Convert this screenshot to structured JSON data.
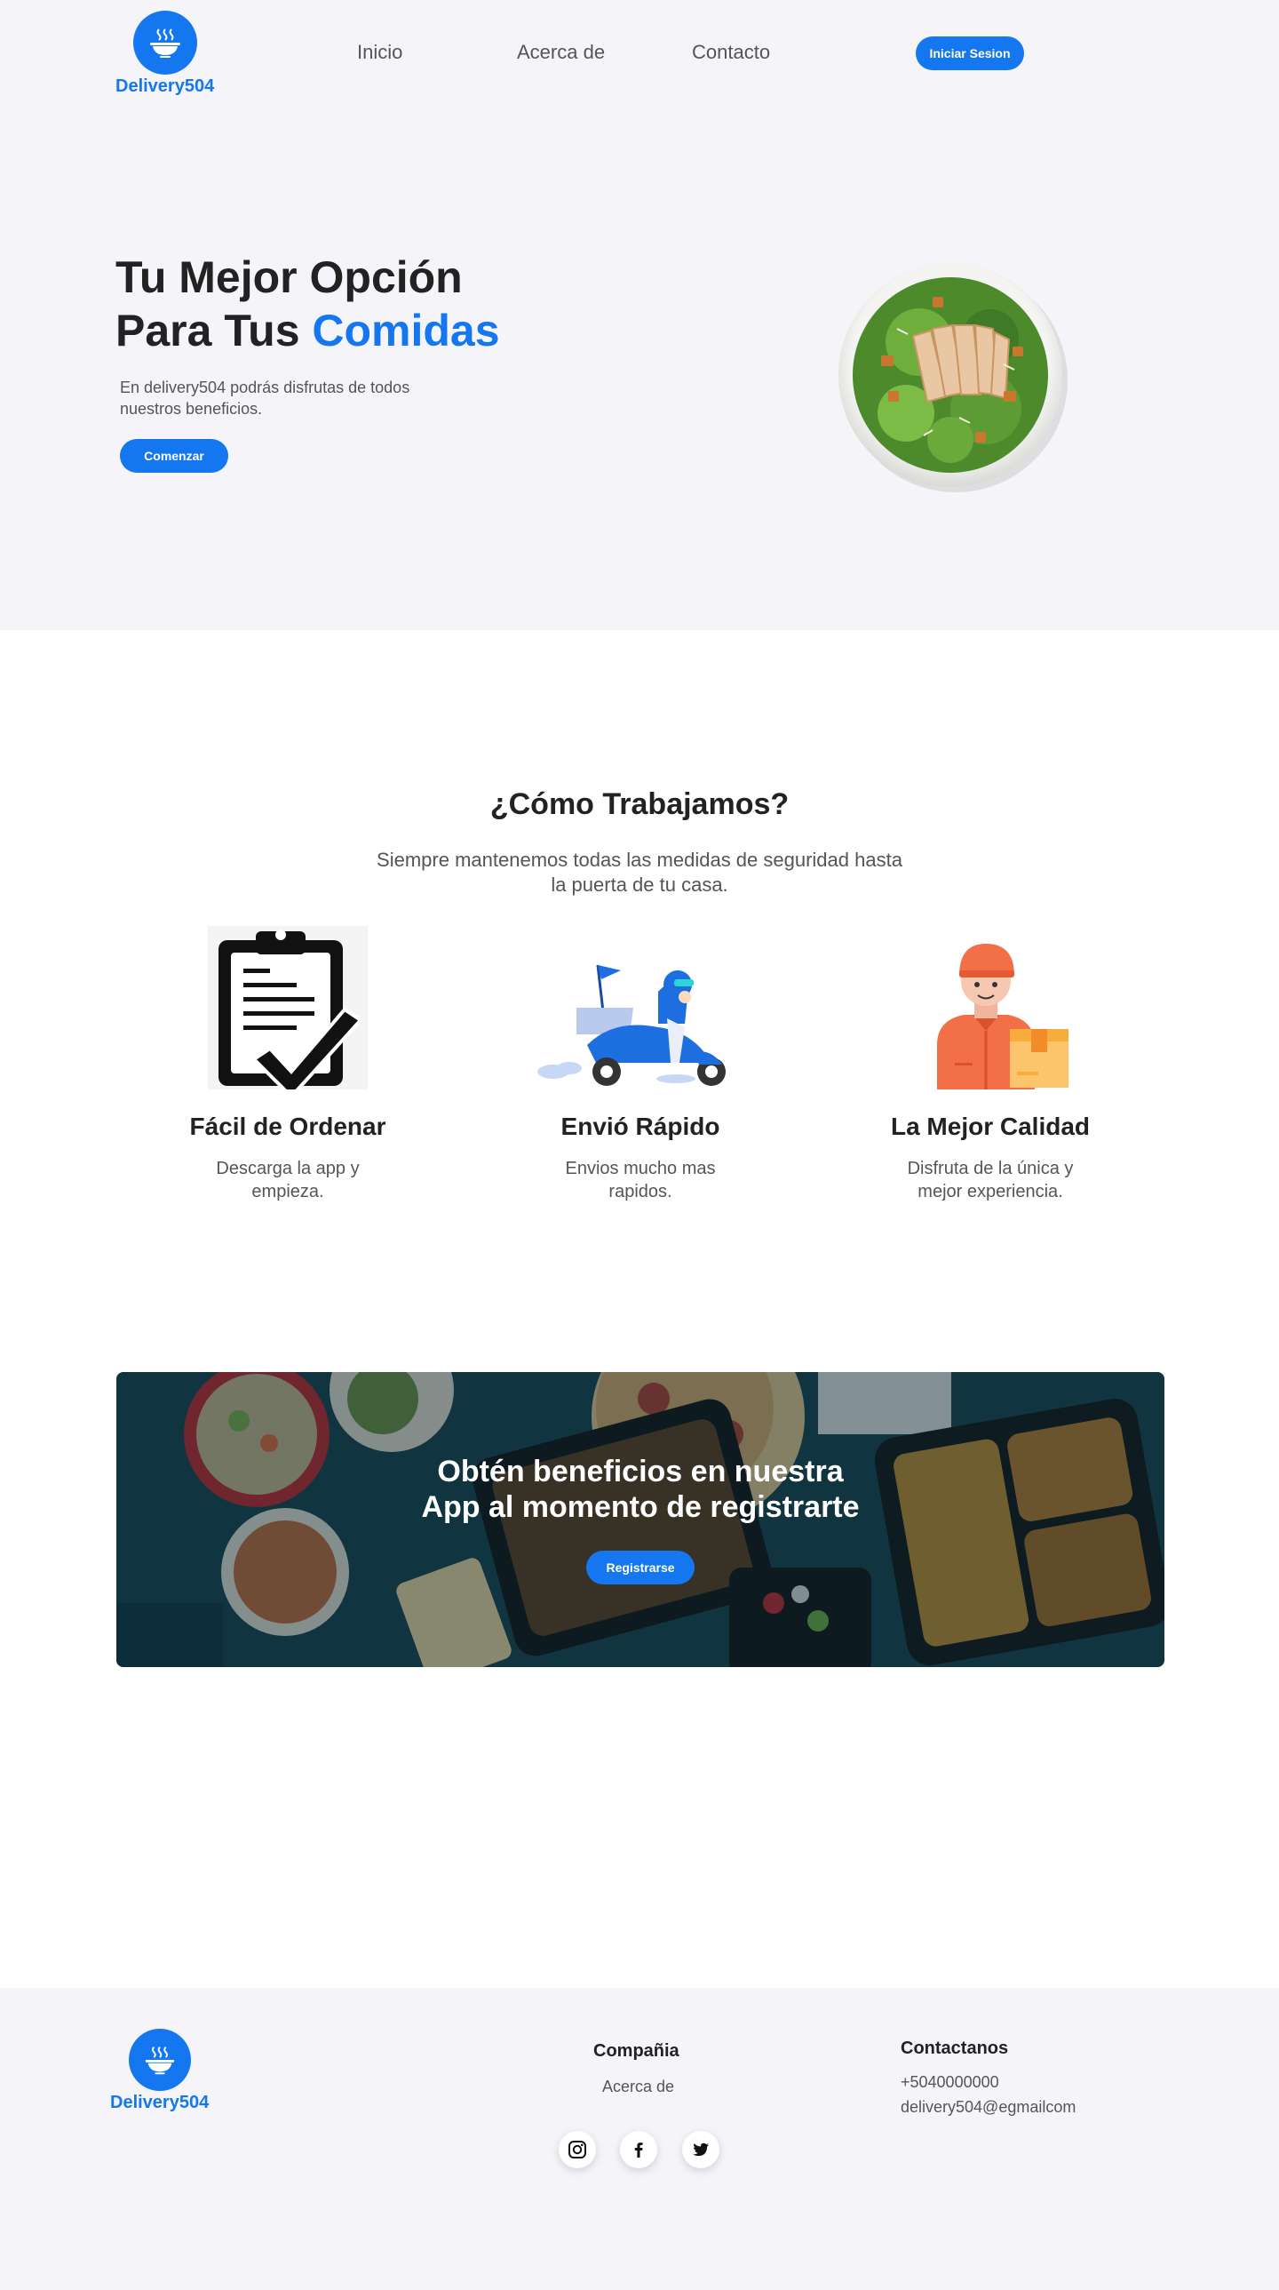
{
  "brand": {
    "name": "Delivery504",
    "color": "#1477f0"
  },
  "nav": {
    "items": [
      {
        "label": "Inicio"
      },
      {
        "label": "Acerca de"
      },
      {
        "label": "Contacto"
      }
    ],
    "login_label": "Iniciar Sesion"
  },
  "hero": {
    "title_line1": "Tu Mejor Opción",
    "title_line2_prefix": "Para Tus ",
    "title_line2_accent": "Comidas",
    "description": "En delivery504 podrás disfrutas de todos nuestros beneficios.",
    "cta_label": "Comenzar",
    "image_icon": "salad-plate-image"
  },
  "how": {
    "title": "¿Cómo Trabajamos?",
    "subtitle": "Siempre mantenemos todas las medidas de seguridad hasta la puerta de tu casa.",
    "features": [
      {
        "title": "Fácil de Ordenar",
        "description": "Descarga la app y empieza.",
        "icon": "clipboard-check-icon"
      },
      {
        "title": "Envió Rápido",
        "description": "Envios mucho mas rapidos.",
        "icon": "delivery-scooter-icon"
      },
      {
        "title": "La Mejor Calidad",
        "description": "Disfruta de la única y mejor experiencia.",
        "icon": "delivery-person-icon"
      }
    ]
  },
  "promo": {
    "title_line1": "Obtén beneficios en nuestra",
    "title_line2": "App al momento de registrarte",
    "cta_label": "Registrarse"
  },
  "footer": {
    "brand": "Delivery504",
    "company_heading": "Compañia",
    "company_links": [
      {
        "label": "Acerca de"
      }
    ],
    "contact_heading": "Contactanos",
    "phone": "+5040000000",
    "email": "delivery504@egmailcom",
    "social": [
      {
        "icon": "instagram-icon"
      },
      {
        "icon": "facebook-icon"
      },
      {
        "icon": "twitter-icon"
      }
    ]
  }
}
